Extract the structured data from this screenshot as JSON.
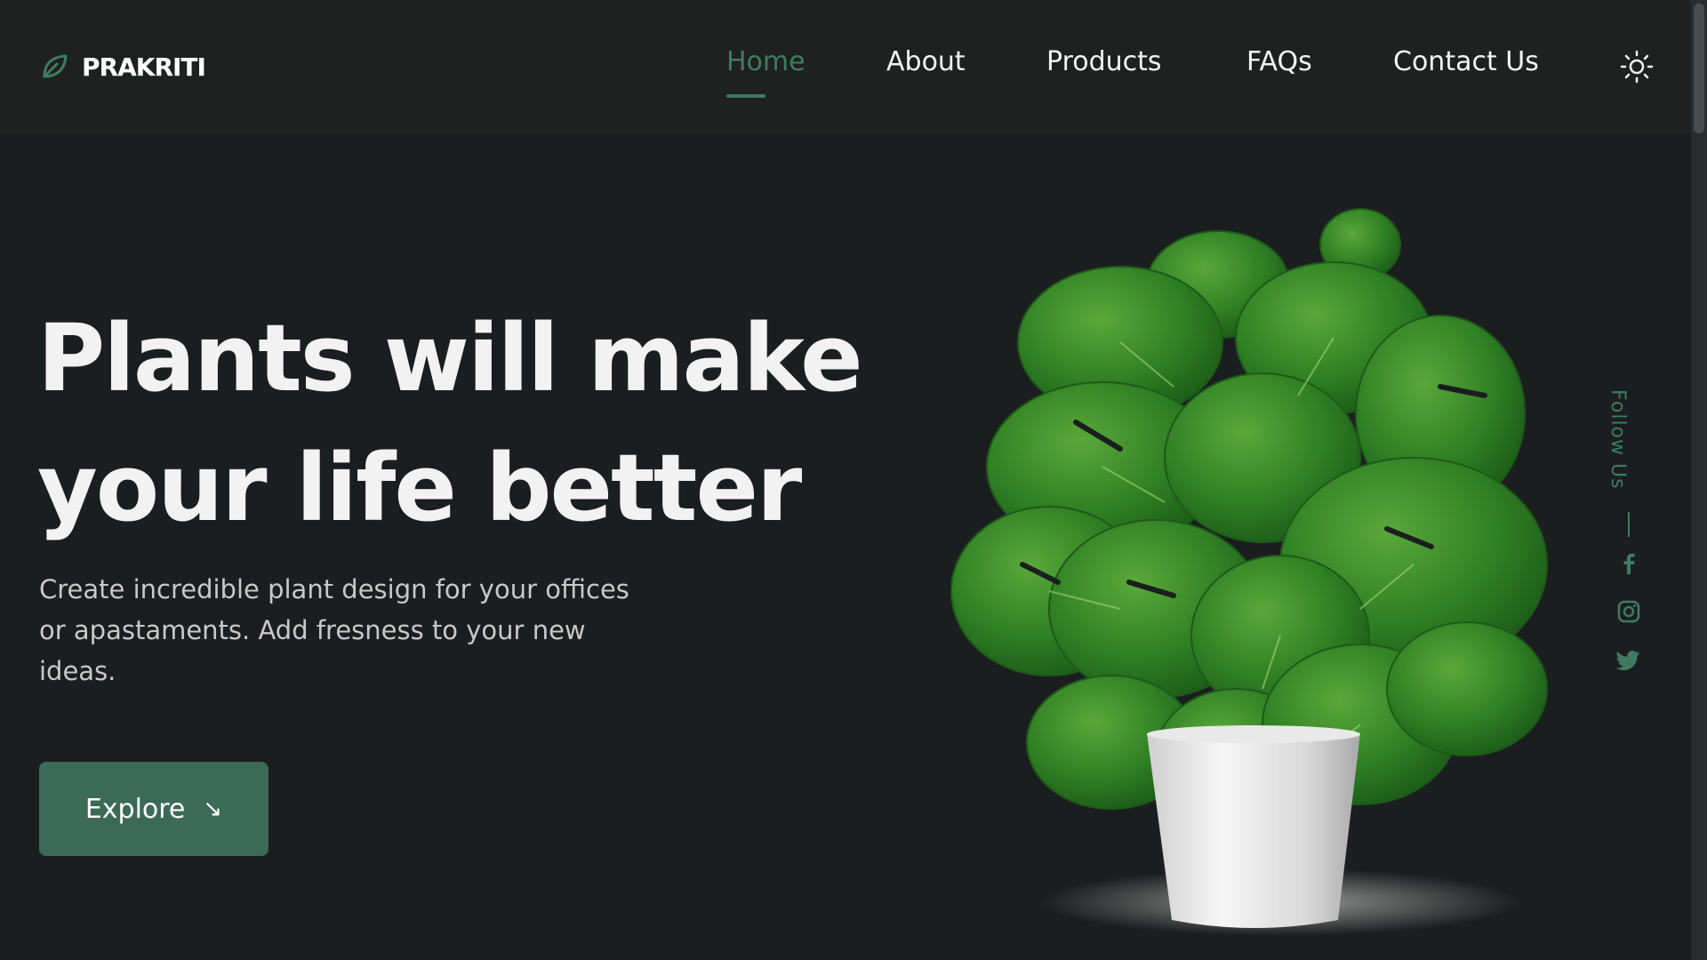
{
  "brand": {
    "name": "PRAKRITI",
    "logo_icon": "leaf-icon"
  },
  "nav": {
    "items": [
      {
        "label": "Home",
        "active": true
      },
      {
        "label": "About",
        "active": false
      },
      {
        "label": "Products",
        "active": false
      },
      {
        "label": "FAQs",
        "active": false
      },
      {
        "label": "Contact Us",
        "active": false
      }
    ],
    "theme_icon": "sun-icon"
  },
  "hero": {
    "title_line1": "Plants will make",
    "title_line2": "your life better",
    "description": "Create incredible plant design for your offices or apastaments. Add fresness to your new ideas.",
    "button_label": "Explore",
    "button_icon": "arrow-down-right-icon",
    "image": "monstera-plant-in-white-pot"
  },
  "social": {
    "label": "Follow Us",
    "icons": [
      "facebook-icon",
      "instagram-icon",
      "twitter-icon"
    ]
  },
  "colors": {
    "background": "#1b1e1e",
    "header": "#1e2120",
    "accent": "#3f7b64",
    "button": "#3c6a58",
    "text": "#f2f2f2"
  }
}
